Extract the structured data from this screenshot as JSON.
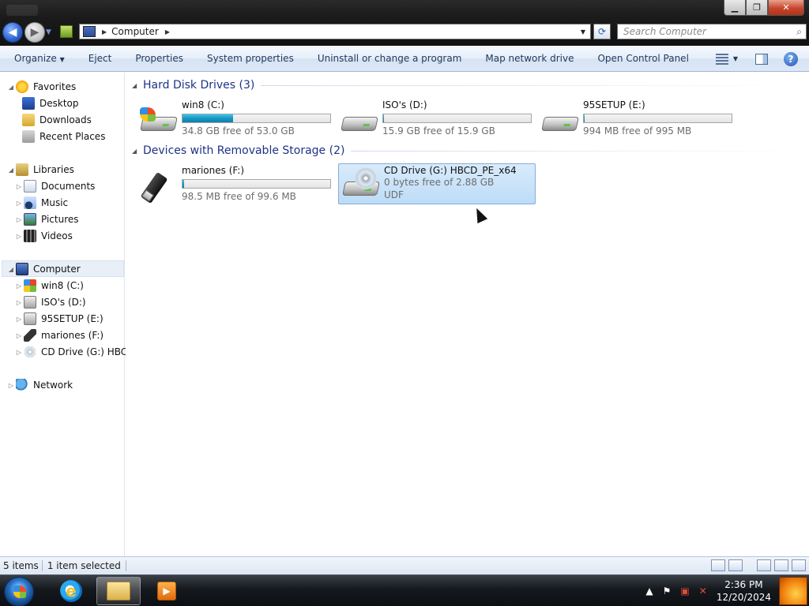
{
  "window": {
    "minimize_icon": "minimize-icon",
    "maximize_icon": "maximize-icon",
    "close_icon": "close-icon"
  },
  "address": {
    "location": "Computer",
    "search_placeholder": "Search Computer"
  },
  "toolbar": {
    "organize": "Organize",
    "eject": "Eject",
    "properties": "Properties",
    "system_properties": "System properties",
    "uninstall": "Uninstall or change a program",
    "map_drive": "Map network drive",
    "control_panel": "Open Control Panel"
  },
  "nav": {
    "favorites": "Favorites",
    "desktop": "Desktop",
    "downloads": "Downloads",
    "recent": "Recent Places",
    "libraries": "Libraries",
    "documents": "Documents",
    "music": "Music",
    "pictures": "Pictures",
    "videos": "Videos",
    "computer": "Computer",
    "drive_c": "win8 (C:)",
    "drive_d": "ISO's (D:)",
    "drive_e": "95SETUP (E:)",
    "drive_f": "mariones (F:)",
    "drive_g": "CD Drive (G:) HBCD_",
    "network": "Network"
  },
  "groups": {
    "hdd": "Hard Disk Drives (3)",
    "removable": "Devices with Removable Storage (2)"
  },
  "drives": [
    {
      "name": "win8 (C:)",
      "free": "34.8 GB free of 53.0 GB",
      "used_fraction": 0.34
    },
    {
      "name": "ISO's (D:)",
      "free": "15.9 GB free of 15.9 GB",
      "used_fraction": 0.0
    },
    {
      "name": "95SETUP (E:)",
      "free": "994 MB free of 995 MB",
      "used_fraction": 0.0
    },
    {
      "name": "mariones (F:)",
      "free": "98.5 MB free of 99.6 MB",
      "used_fraction": 0.01
    },
    {
      "name": "CD Drive (G:) HBCD_PE_x64",
      "free": "0 bytes free of 2.88 GB",
      "fs": "UDF"
    }
  ],
  "status": {
    "items": "5 items",
    "selected": "1 item selected"
  },
  "clock": {
    "time": "2:36 PM",
    "date": "12/20/2024"
  }
}
